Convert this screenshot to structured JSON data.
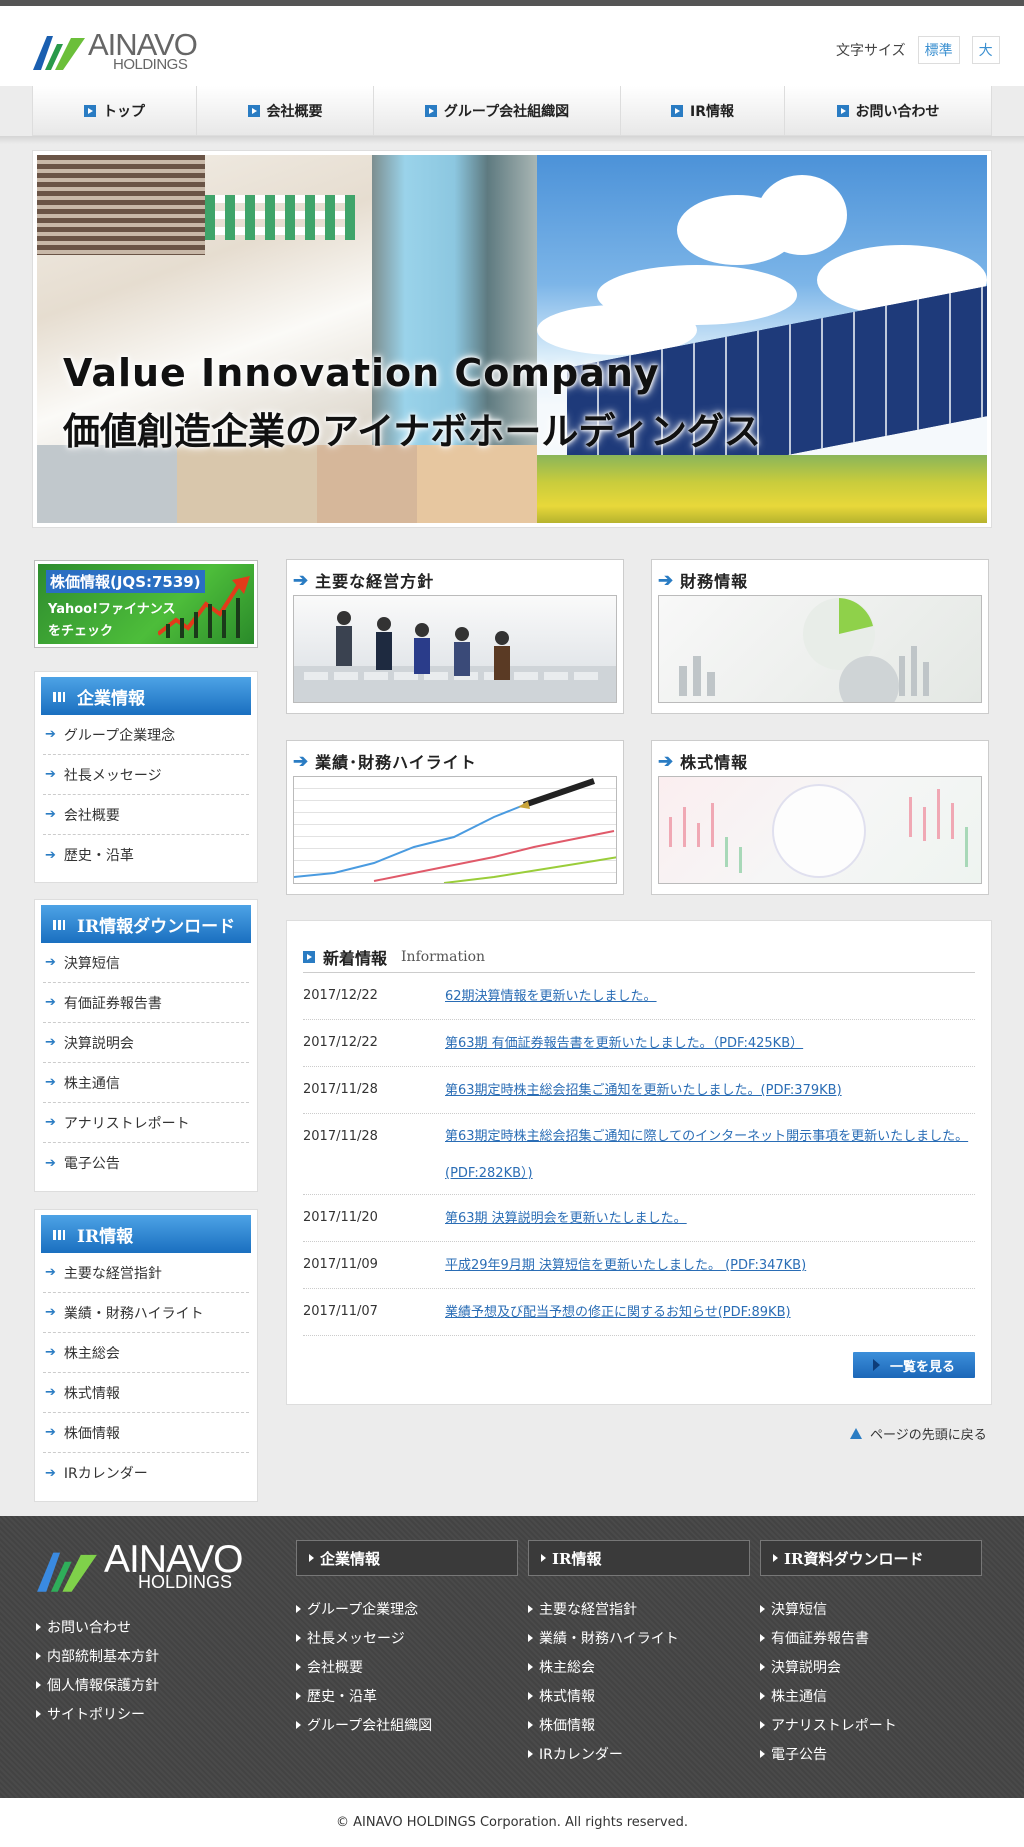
{
  "header": {
    "logo_text": "AINAVO",
    "logo_sub": "HOLDINGS",
    "fontsize_label": "文字サイズ",
    "fontsize_normal": "標準",
    "fontsize_large": "大"
  },
  "nav": {
    "items": [
      {
        "label": "トップ"
      },
      {
        "label": "会社概要"
      },
      {
        "label": "グループ会社組織図"
      },
      {
        "label": "IR情報"
      },
      {
        "label": "お問い合わせ"
      }
    ]
  },
  "hero": {
    "line1": "Value Innovation Company",
    "line2": "価値創造企業のアイナボホールディングス"
  },
  "stock_banner": {
    "title": "株価情報(JQS:7539)",
    "line2": "Yahoo!ファイナンス",
    "line3": "をチェック"
  },
  "sidebar": {
    "corporate": {
      "title": "企業情報",
      "items": [
        "グループ企業理念",
        "社長メッセージ",
        "会社概要",
        "歴史・沿革"
      ]
    },
    "ir_download": {
      "title": "IR情報ダウンロード",
      "items": [
        "決算短信",
        "有価証券報告書",
        "決算説明会",
        "株主通信",
        "アナリストレポート",
        "電子公告"
      ]
    },
    "ir": {
      "title": "IR情報",
      "items": [
        "主要な経営指針",
        "業績・財務ハイライト",
        "株主総会",
        "株式情報",
        "株価情報",
        "IRカレンダー"
      ]
    }
  },
  "cards": [
    {
      "title": "主要な経営方針"
    },
    {
      "title": "財務情報"
    },
    {
      "title": "業績･財務ハイライト"
    },
    {
      "title": "株式情報"
    }
  ],
  "news": {
    "title": "新着情報",
    "title_en": "Information",
    "items": [
      {
        "date": "2017/12/22",
        "text": "62期決算情報を更新いたしました。"
      },
      {
        "date": "2017/12/22",
        "text": "第63期 有価証券報告書を更新いたしました。（PDF:425KB）"
      },
      {
        "date": "2017/11/28",
        "text": "第63期定時株主総会招集ご通知を更新いたしました。(PDF:379KB)"
      },
      {
        "date": "2017/11/28",
        "text": "第63期定時株主総会招集ご通知に際してのインターネット開示事項を更新いたしました。(PDF:282KB）)"
      },
      {
        "date": "2017/11/20",
        "text": "第63期 決算説明会を更新いたしました。"
      },
      {
        "date": "2017/11/09",
        "text": "平成29年9月期 決算短信を更新いたしました。 (PDF:347KB)"
      },
      {
        "date": "2017/11/07",
        "text": "業績予想及び配当予想の修正に関するお知らせ(PDF:89KB)"
      }
    ],
    "more_label": "一覧を見る"
  },
  "page_top": "ページの先頭に戻る",
  "footer": {
    "logo_text": "AINAVO",
    "logo_sub": "HOLDINGS",
    "links": [
      "お問い合わせ",
      "内部統制基本方針",
      "個人情報保護方針",
      "サイトポリシー"
    ],
    "columns": [
      {
        "title": "企業情報",
        "items": [
          "グループ企業理念",
          "社長メッセージ",
          "会社概要",
          "歴史・沿革",
          "グループ会社組織図"
        ]
      },
      {
        "title": "IR情報",
        "items": [
          "主要な経営指針",
          "業績・財務ハイライト",
          "株主総会",
          "株式情報",
          "株価情報",
          "IRカレンダー"
        ]
      },
      {
        "title": "IR資料ダウンロード",
        "items": [
          "決算短信",
          "有価証券報告書",
          "決算説明会",
          "株主通信",
          "アナリストレポート",
          "電子公告"
        ]
      }
    ],
    "copyright": "© AINAVO HOLDINGS Corporation. All rights reserved."
  },
  "colors": {
    "accent": "#2a7cc3",
    "link": "#2a6db5",
    "footer_bg": "#4a4a4a"
  }
}
